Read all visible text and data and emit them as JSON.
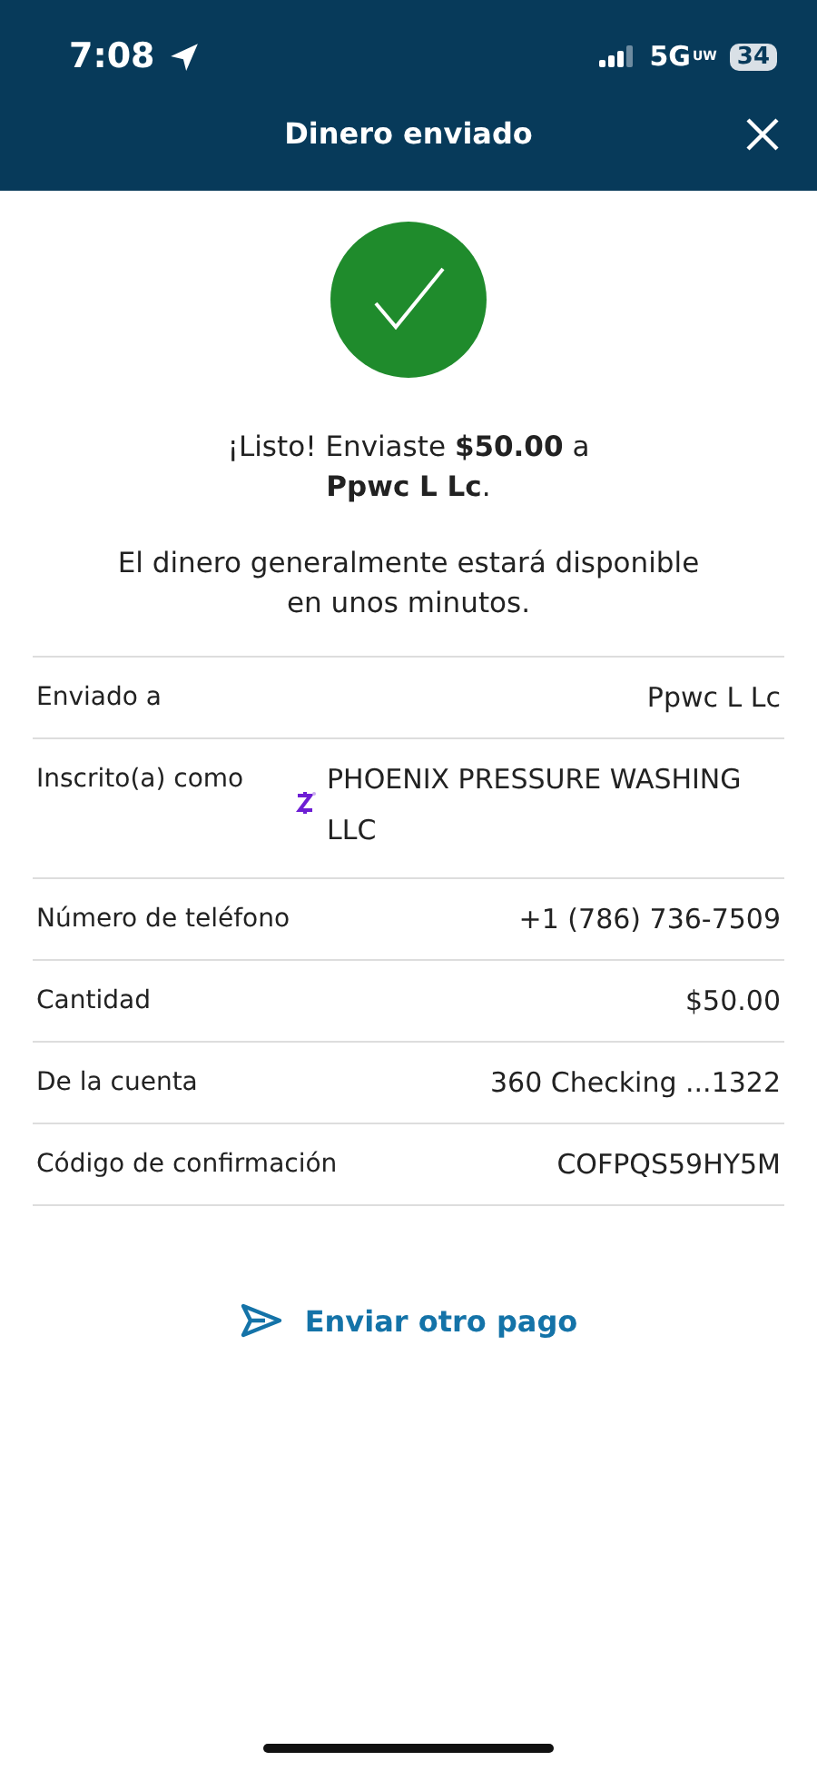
{
  "status_bar": {
    "time": "7:08",
    "network": "5G",
    "network_suffix": "UW",
    "battery": "34"
  },
  "header": {
    "title": "Dinero enviado"
  },
  "confirmation": {
    "message": "¡Listo! Enviaste **$50.00** a",
    "recipient": "**Ppwc L Lc**.",
    "note": "El dinero generalmente estará disponible en unos minutos."
  },
  "details": [
    {
      "kind": "plain",
      "label": "Enviado a",
      "value": "Ppwc L Lc"
    },
    {
      "kind": "enrolled",
      "label": "Inscrito(a) como",
      "value": "PHOENIX PRESSURE WASHING LLC"
    },
    {
      "kind": "plain",
      "label": "Número de teléfono",
      "value": "+1 (786) 736-7509"
    },
    {
      "kind": "plain",
      "label": "Cantidad",
      "value": "$50.00"
    },
    {
      "kind": "plain",
      "label": "De la cuenta",
      "value": "360 Checking ...1322"
    },
    {
      "kind": "plain",
      "label": "Código de confirmación",
      "value": "COFPQS59HY5M"
    }
  ],
  "action": {
    "label": "Enviar otro pago"
  }
}
